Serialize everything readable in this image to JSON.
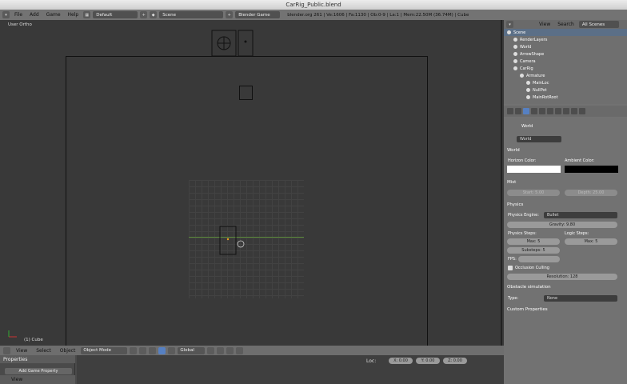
{
  "window": {
    "title": "CarRig_Public.blend"
  },
  "topbar": {
    "menus": [
      "File",
      "Add",
      "Game",
      "Help"
    ],
    "layout": "Default",
    "scene": "Scene",
    "engine": "Blender Game",
    "info": "blender.org 261 | Ve:1606 | Fa:1130 | Ob:0-9 | La:1 | Mem:22.50M (36.74M) | Cube"
  },
  "viewport": {
    "view_label": "User Ortho",
    "object_label": "(1) Cube"
  },
  "viewport_header": {
    "menus": [
      "View",
      "Select",
      "Object"
    ],
    "mode": "Object Mode",
    "pivot": "Global"
  },
  "bottom": {
    "properties_label": "Properties",
    "add_game_property": "Add Game Property",
    "view_label": "View",
    "loc_label": "Loc:",
    "loc_x": "X: 0.00",
    "loc_y": "Y: 0.00",
    "loc_z": "Z: 0.00"
  },
  "outliner": {
    "menus": [
      "View",
      "Search"
    ],
    "filter": "All Scenes",
    "rows": [
      {
        "label": "Scene",
        "indent": 0
      },
      {
        "label": "RenderLayers",
        "indent": 1
      },
      {
        "label": "World",
        "indent": 1
      },
      {
        "label": "ArrowShape",
        "indent": 1
      },
      {
        "label": "Camera",
        "indent": 1
      },
      {
        "label": "CarRig",
        "indent": 1
      },
      {
        "label": "Armature",
        "indent": 2
      },
      {
        "label": "MainLoc",
        "indent": 3
      },
      {
        "label": "NullPot",
        "indent": 3
      },
      {
        "label": "MainRotRoot",
        "indent": 3
      }
    ]
  },
  "properties": {
    "breadcrumb": "World",
    "world_name": "World",
    "world_section": "World",
    "horizon_color_label": "Horizon Color:",
    "ambient_color_label": "Ambient Color:",
    "horizon_color": "#ffffff",
    "ambient_color": "#000000",
    "mist_label": "Mist",
    "mist_start": "Start: 5.00",
    "mist_depth": "Depth: 25.00",
    "physics_section": "Physics",
    "physics_engine_label": "Physics Engine:",
    "physics_engine": "Bullet",
    "gravity": "Gravity: 9.80",
    "physics_steps_label": "Physics Steps:",
    "logic_steps_label": "Logic Steps:",
    "phys_max": "Max: 5",
    "logic_max": "Max: 5",
    "substeps": "Substeps: 5",
    "fps_label": "FPS:",
    "occlusion_label": "Occlusion Culling",
    "resolution": "Resolution: 128",
    "obstacle_section": "Obstacle simulation",
    "type_label": "Type:",
    "type_value": "None",
    "custom_props": "Custom Properties"
  }
}
